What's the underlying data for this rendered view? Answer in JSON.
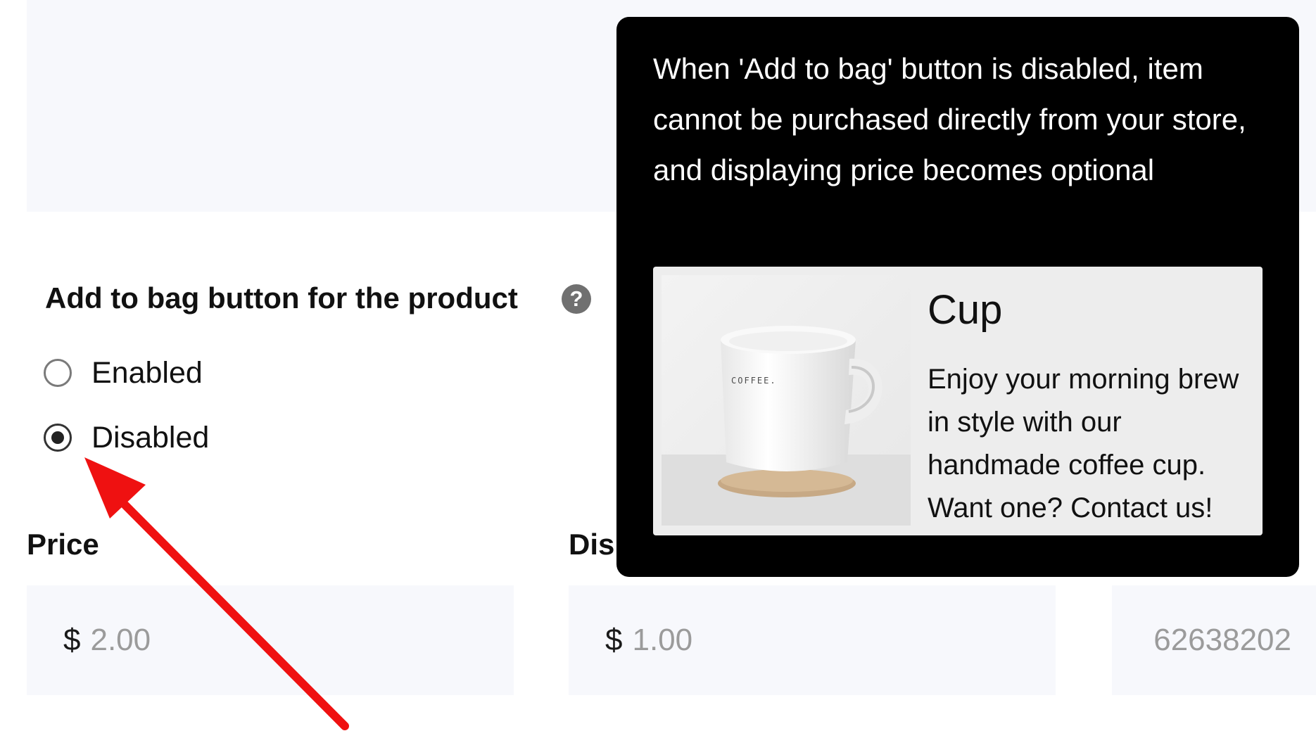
{
  "section": {
    "title": "Add to bag button for the product",
    "help_glyph": "?"
  },
  "radio_options": [
    {
      "label": "Enabled",
      "selected": false
    },
    {
      "label": "Disabled",
      "selected": true
    }
  ],
  "fields": {
    "price": {
      "label": "Price",
      "currency_symbol": "$",
      "value": "2.00"
    },
    "discount": {
      "label_visible": "Dis",
      "currency_symbol": "$",
      "value": "1.00"
    },
    "code": {
      "value": "62638202"
    }
  },
  "tooltip": {
    "text": "When 'Add to bag' button is disabled, item cannot be purchased directly from your store, and displaying price becomes optional",
    "preview": {
      "title": "Cup",
      "description": "Enjoy your morning brew in style with our handmade coffee cup. Want one? Contact us!",
      "image_label": "COFFEE."
    }
  },
  "colors": {
    "panel_background": "#f7f8fc",
    "tooltip_background": "#000000",
    "card_background": "#ededed",
    "arrow_red": "#ef1111",
    "placeholder_text": "#9b9b9b"
  },
  "icons": {
    "help": "help-icon",
    "annotation": "red-arrow-icon",
    "radio": "radio-icon"
  }
}
